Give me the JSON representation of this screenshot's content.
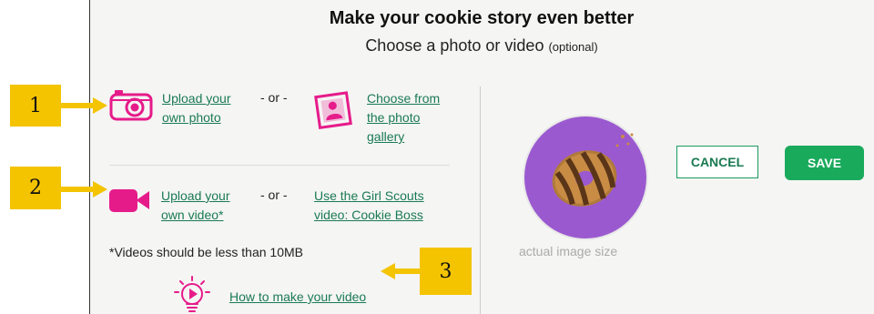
{
  "header": {
    "title": "Make your cookie story even better",
    "subtitle": "Choose a photo or video",
    "subtitle_optional": "(optional)"
  },
  "photo_row": {
    "upload_label": "Upload your\nown photo",
    "or_label": "- or -",
    "gallery_label": "Choose from\nthe photo\ngallery"
  },
  "video_row": {
    "upload_label": "Upload your\nown video*",
    "or_label": "- or -",
    "scouts_label": "Use the Girl Scouts\nvideo: Cookie Boss"
  },
  "video_note": "*Videos should be less than 10MB",
  "howto_label": "How to make your video",
  "preview": {
    "caption": "actual image size"
  },
  "buttons": {
    "cancel": "CANCEL",
    "save": "SAVE"
  },
  "callouts": {
    "c1": "1",
    "c2": "2",
    "c3": "3"
  },
  "colors": {
    "link": "#1a7a52",
    "accent_pink": "#e61b8a",
    "save_green": "#1aaa5c",
    "callout_yellow": "#f4c400",
    "preview_purple": "#9b59d0"
  }
}
